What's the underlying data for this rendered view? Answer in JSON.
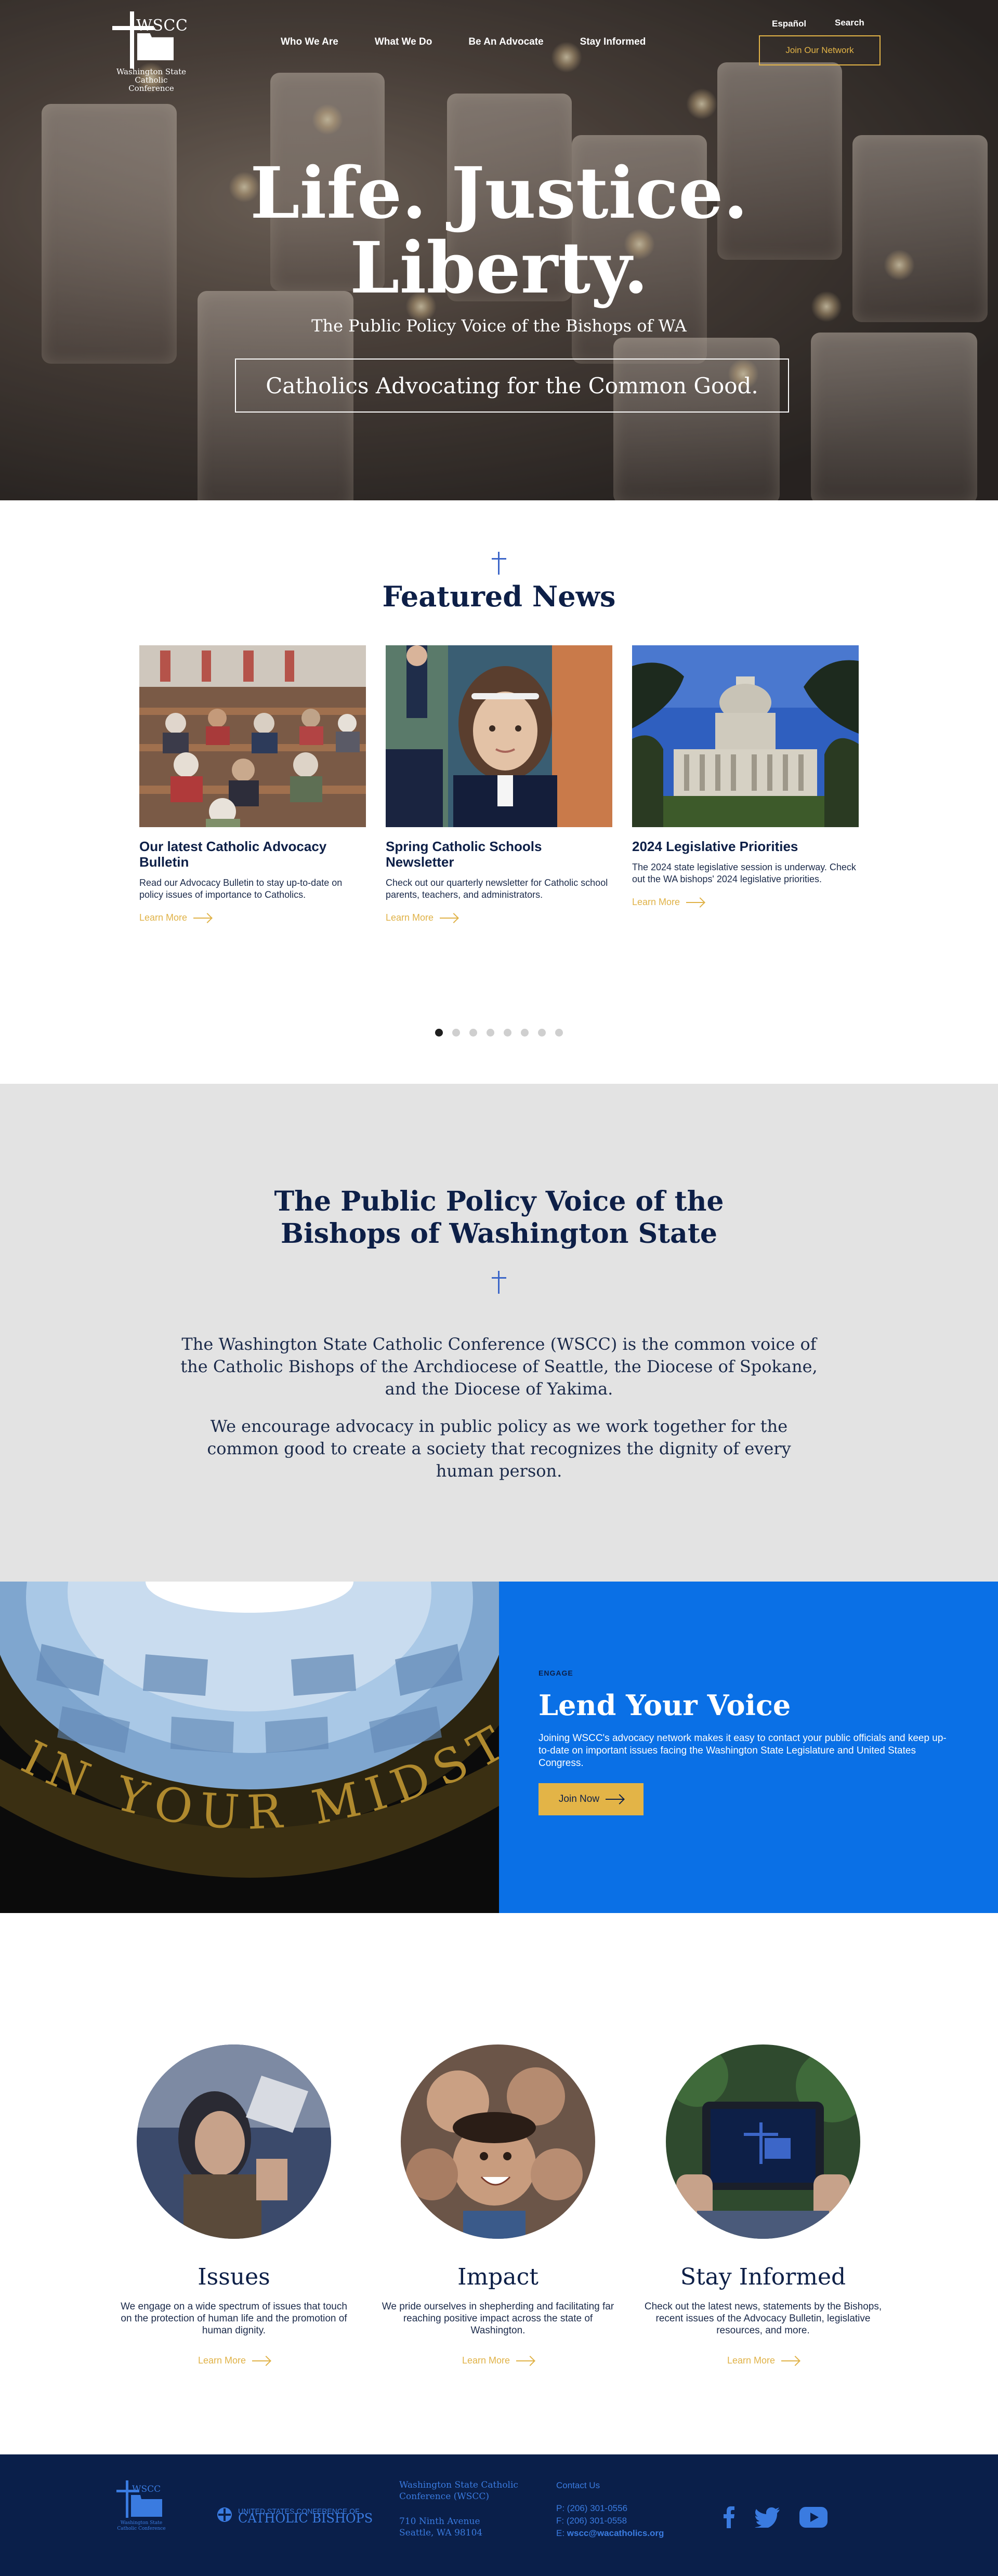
{
  "header": {
    "logo_wscc": "WSCC",
    "logo_sub1": "Washington State",
    "logo_sub2": "Catholic Conference",
    "nav": [
      "Who We Are",
      "What We Do",
      "Be An Advocate",
      "Stay Informed"
    ],
    "language": "Español",
    "search": "Search",
    "join_button": "Join Our Network"
  },
  "hero": {
    "title_line1": "Life. Justice.",
    "title_line2": "Liberty.",
    "subtitle": "The Public Policy Voice of the Bishops of WA",
    "banner": "Catholics Advocating for the Common Good."
  },
  "featured": {
    "title": "Featured News",
    "cards": [
      {
        "title": "Our latest Catholic Advocacy Bulletin",
        "text": "Read our Advocacy Bulletin to stay up-to-date on policy issues of importance to Catholics.",
        "more": "Learn More"
      },
      {
        "title": "Spring Catholic Schools Newsletter",
        "text": "Check out our quarterly newsletter for Catholic school parents, teachers, and administrators.",
        "more": "Learn More"
      },
      {
        "title": "2024 Legislative Priorities",
        "text": "The 2024 state legislative session is underway. Check out the WA bishops' 2024 legislative priorities.",
        "more": "Learn More"
      }
    ],
    "dots_total": 8,
    "dots_active": 1
  },
  "voice": {
    "title_line1": "The Public Policy Voice of the",
    "title_line2": "Bishops of Washington State",
    "p1": "The Washington State Catholic Conference (WSCC) is the common voice of the Catholic Bishops of the Archdiocese of Seattle, the Diocese of Spokane, and the Diocese of Yakima.",
    "p2": "We encourage advocacy in public policy as we work together for the common good to create a society that recognizes the dignity of every human person."
  },
  "engage": {
    "dome_text": "IN YOUR MIDST",
    "label": "ENGAGE",
    "title": "Lend Your Voice",
    "text": "Joining WSCC's advocacy network makes it easy to contact your public officials and keep up-to-date on important issues facing the Washington State Legislature and United States Congress.",
    "button": "Join Now"
  },
  "features": [
    {
      "title": "Issues",
      "text": "We engage on a wide spectrum of issues that touch on the protection of human life and the promotion of human dignity.",
      "more": "Learn More"
    },
    {
      "title": "Impact",
      "text": "We pride ourselves in shepherding and facilitating far reaching positive impact across the state of Washington.",
      "more": "Learn More"
    },
    {
      "title": "Stay Informed",
      "text": "Check out the latest news, statements by the Bishops, recent issues of the Advocacy Bulletin, legislative resources, and more.",
      "more": "Learn More"
    }
  ],
  "footer": {
    "usccb_small": "UNITED STATES CONFERENCE OF",
    "usccb_big": "CATHOLIC BISHOPS",
    "org_line1": "Washington State Catholic",
    "org_line2": "Conference (WSCC)",
    "street": "710 Ninth Avenue",
    "city": "Seattle, WA 98104",
    "contact_title": "Contact Us",
    "phone": "P: (206) 301-0556",
    "fax": "F: (206) 301-0558",
    "email_label": "E:",
    "email": "wscc@wacatholics.org"
  },
  "colors": {
    "navy": "#0d1f47",
    "gold": "#e3b447",
    "blue": "#0a70e6",
    "footer": "#0a1f4a",
    "gray": "#e3e3e3"
  }
}
